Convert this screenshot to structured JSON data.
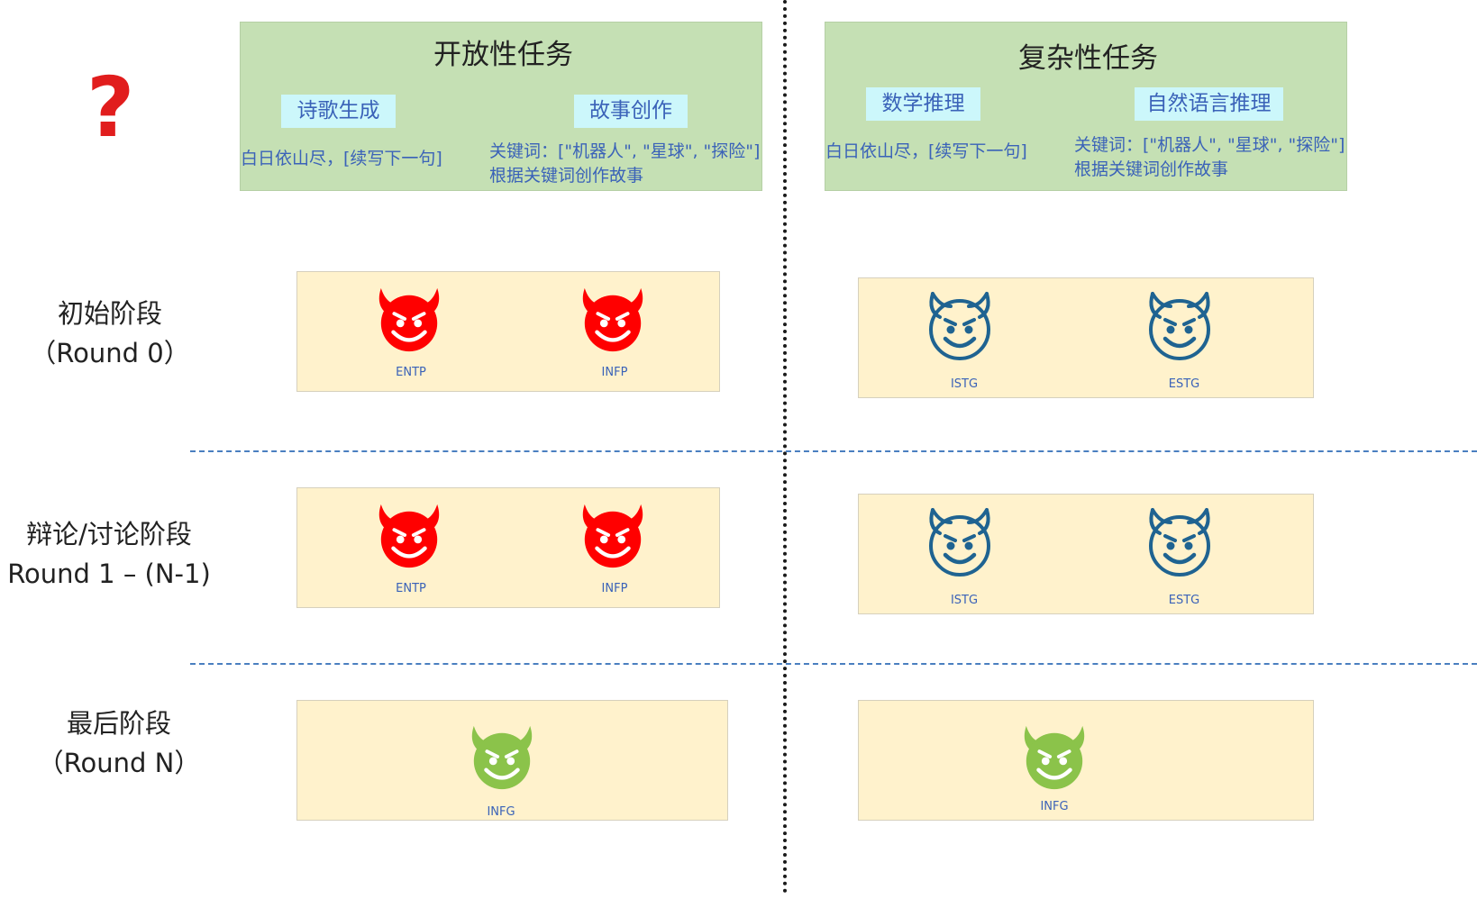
{
  "question_mark": "?",
  "colors": {
    "red": "#ff0000",
    "blue": "#1f6391",
    "green": "#8bc34a",
    "panel": "#c5e0b4",
    "box": "#fff2cc",
    "chip": "#ccf7fb"
  },
  "open_task": {
    "title": "开放性任务",
    "chip_left": "诗歌生成",
    "chip_right": "故事创作",
    "example_left": "白日依山尽，[续写下一句]",
    "example_right_line1": "关键词：[\"机器人\", \"星球\", \"探险\"]",
    "example_right_line2": "根据关键词创作故事"
  },
  "complex_task": {
    "title": "复杂性任务",
    "chip_left": "数学推理",
    "chip_right": "自然语言推理",
    "example_left": "白日依山尽，[续写下一句]",
    "example_right_line1": "关键词：[\"机器人\", \"星球\", \"探险\"]",
    "example_right_line2": "根据关键词创作故事"
  },
  "stages": {
    "initial": {
      "line1": "初始阶段",
      "line2": "（Round 0）"
    },
    "debate": {
      "line1": "辩论/讨论阶段",
      "line2": "Round 1 – (N-1)"
    },
    "final": {
      "line1": "最后阶段",
      "line2": "（Round N）"
    }
  },
  "agents": {
    "initial_left": [
      "ENTP",
      "INFP"
    ],
    "initial_right": [
      "ISTG",
      "ESTG"
    ],
    "debate_left": [
      "ENTP",
      "INFP"
    ],
    "debate_right": [
      "ISTG",
      "ESTG"
    ],
    "final_left": "INFG",
    "final_right": "INFG"
  }
}
